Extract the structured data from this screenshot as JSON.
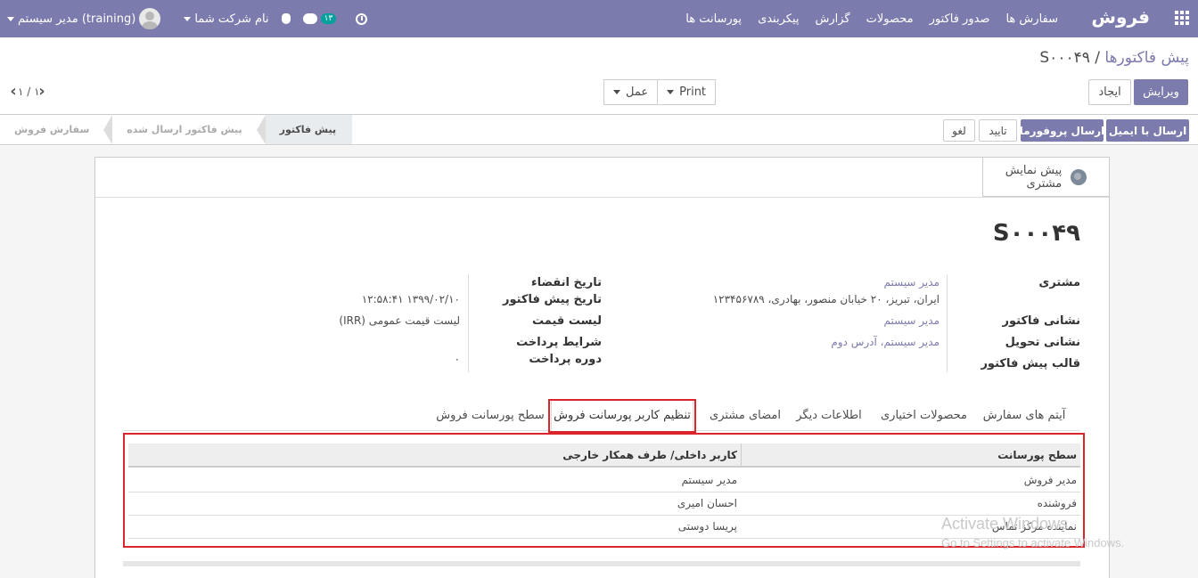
{
  "navbar": {
    "brand": "فروش",
    "menu": [
      "سفارش ها",
      "صدور فاکتور",
      "محصولات",
      "گزارش",
      "پیکربندی",
      "پورسانت ها"
    ],
    "company": "نام شرکت شما",
    "user": "مدیر سیستم (training)",
    "messages_count": "۱۳"
  },
  "breadcrumb": {
    "parent": "پیش فاکتورها",
    "separator": "/",
    "current": "S۰۰۰۴۹"
  },
  "buttons": {
    "edit": "ویرایش",
    "create": "ایجاد",
    "print": "Print",
    "action": "عمل"
  },
  "pager": {
    "value": "۱ / ۱"
  },
  "statusbar": {
    "send_email": "ارسال با ایمیل",
    "send_proforma": "ارسال پروفورما",
    "confirm": "تایید",
    "cancel": "لغو",
    "stages": [
      "سفارش فروش",
      "پیش فاکتور ارسال شده",
      "پیش فاکتور"
    ],
    "active_stage": "پیش فاکتور"
  },
  "smart_button": {
    "line1": "پیش نمایش",
    "line2": "مشتری"
  },
  "order": {
    "name": "S۰۰۰۴۹",
    "customer_label": "مشتری",
    "customer_name": "مدیر سیستم",
    "customer_address": "ایران، تبریز، ۲۰ خیابان منصور، بهادری، ۱۲۳۴۵۶۷۸۹",
    "invoice_address_label": "نشانی فاکتور",
    "invoice_address": "مدیر سیستم",
    "delivery_address_label": "نشانی تحویل",
    "delivery_address": "مدیر سیستم، آدرس دوم",
    "template_label": "قالب پیش فاکتور",
    "expiry_label": "تاریخ انقضاء",
    "quote_date_label": "تاریخ پیش فاکتور",
    "quote_date": "۱۳۹۹/۰۲/۱۰ ۱۲:۵۸:۴۱",
    "pricelist_label": "لیست قیمت",
    "pricelist": "لیست قیمت عمومی (IRR)",
    "payment_terms_label": "شرایط پرداخت",
    "payment_period_label": "دوره پرداخت",
    "payment_period": "۰"
  },
  "tabs": [
    "آیتم های سفارش",
    "محصولات اختیاری",
    "اطلاعات دیگر",
    "امضای مشتری",
    "تنظیم کاربر پورسانت فروش",
    "سطح پورسانت فروش"
  ],
  "table": {
    "headers": [
      "سطح پورسانت",
      "کاربر داخلی/ طرف همکار خارجی"
    ],
    "rows": [
      [
        "مدیر فروش",
        "مدیر سیستم"
      ],
      [
        "فروشنده",
        "احسان امیری"
      ],
      [
        "نماینده مرکز تماس",
        "پریسا دوستی"
      ]
    ]
  },
  "watermark": {
    "line1": "Activate Windows",
    "line2": "Go to Settings to activate Windows."
  }
}
